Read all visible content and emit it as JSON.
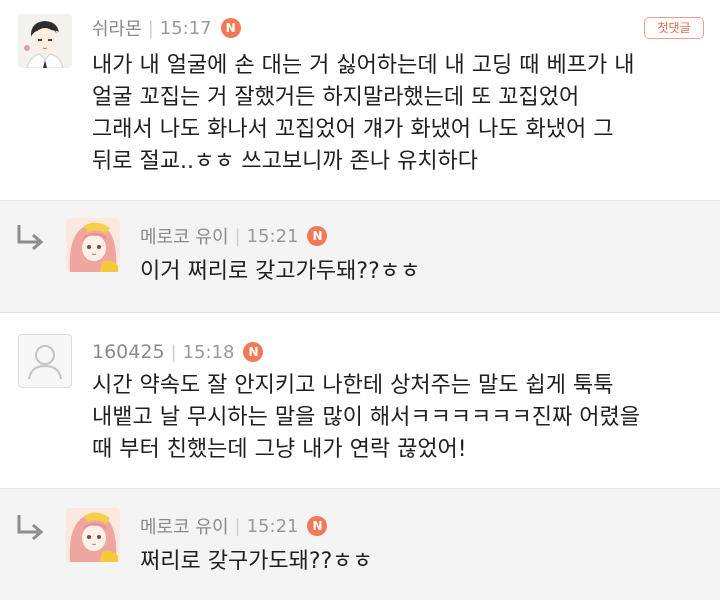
{
  "comments": [
    {
      "author": "쉬라몬",
      "time": "15:17",
      "badge": "N",
      "first_comment_label": "첫댓글",
      "lines": [
        "내가 내 얼굴에 손 대는 거 싫어하는데 내 고딩 때 베프가 내",
        "얼굴 꼬집는 거 잘했거든 하지말라했는데 또 꼬집었어",
        "그래서 나도 화나서 꼬집었어 걔가 화냈어 나도 화냈어 그",
        "뒤로 절교..ㅎㅎ 쓰고보니까 존나 유치하다"
      ]
    },
    {
      "author": "메로코 유이",
      "time": "15:21",
      "badge": "N",
      "lines": [
        "이거 쩌리로 갖고가두돼??ㅎㅎ"
      ]
    },
    {
      "author": "160425",
      "time": "15:18",
      "badge": "N",
      "lines": [
        "시간 약속도 잘 안지키고 나한테 상처주는 말도 쉽게 툭툭",
        "내뱉고 날 무시하는 말을 많이 해서ㅋㅋㅋㅋㅋㅋ진짜 어렸을",
        "때 부터 친했는데 그냥 내가 연락 끊었어!"
      ]
    },
    {
      "author": "메로코 유이",
      "time": "15:21",
      "badge": "N",
      "lines": [
        "쩌리로 갖구가도돼??ㅎㅎ"
      ]
    }
  ],
  "icons": {
    "reply": "reply-arrow-icon",
    "default_avatar": "default-user-icon"
  },
  "colors": {
    "badge": "#f07a55",
    "first_comment": "#ea6a4b",
    "reply_bg": "#f4f4f4"
  }
}
